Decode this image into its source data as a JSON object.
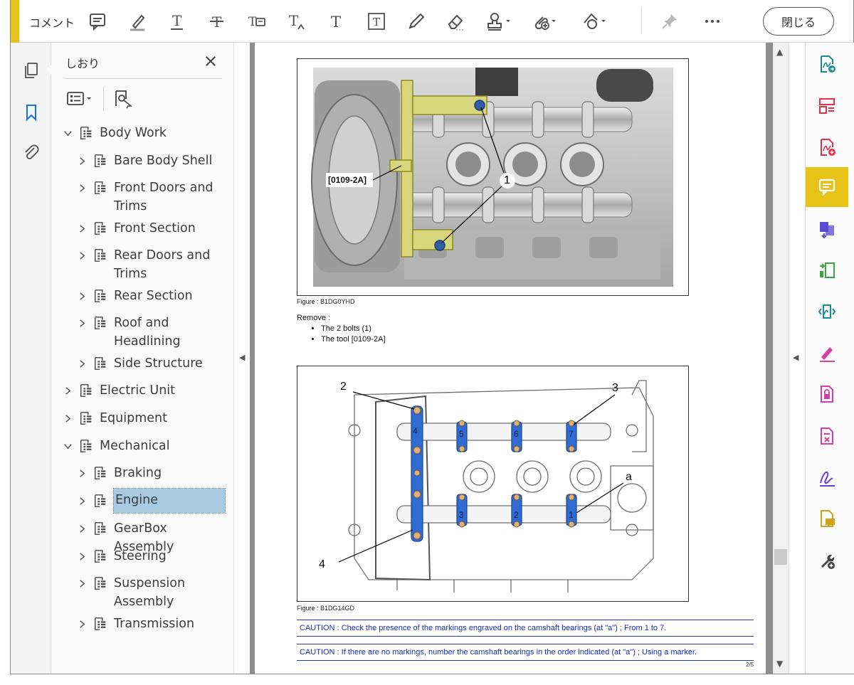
{
  "toolbar": {
    "title": "コメント",
    "close_label": "閉じる",
    "tools": [
      {
        "name": "sticky-note-icon"
      },
      {
        "name": "highlight-icon"
      },
      {
        "name": "underline-text-icon"
      },
      {
        "name": "strikethrough-icon"
      },
      {
        "name": "replace-text-icon"
      },
      {
        "name": "insert-text-icon"
      },
      {
        "name": "add-text-icon"
      },
      {
        "name": "text-box-icon"
      },
      {
        "name": "pencil-icon"
      },
      {
        "name": "eraser-icon"
      },
      {
        "name": "stamp-icon"
      },
      {
        "name": "attach-file-icon"
      },
      {
        "name": "shapes-icon"
      },
      {
        "name": "pin-icon"
      },
      {
        "name": "more-icon"
      }
    ]
  },
  "left_strip": {
    "icons": [
      "page-thumbnails-icon",
      "bookmarks-icon",
      "attachments-icon"
    ]
  },
  "bookmarks": {
    "title": "しおり",
    "tree": [
      {
        "label": "Body Work",
        "level": 0,
        "expanded": true
      },
      {
        "label": "Bare Body Shell",
        "level": 1
      },
      {
        "label": "Front Doors and Trims",
        "level": 1
      },
      {
        "label": "Front Section",
        "level": 1
      },
      {
        "label": "Rear Doors and Trims",
        "level": 1
      },
      {
        "label": "Rear Section",
        "level": 1
      },
      {
        "label": "Roof and Headlining",
        "level": 1
      },
      {
        "label": "Side Structure",
        "level": 1
      },
      {
        "label": "Electric Unit",
        "level": 0
      },
      {
        "label": "Equipment",
        "level": 0
      },
      {
        "label": "Mechanical",
        "level": 0,
        "expanded": true
      },
      {
        "label": "Braking",
        "level": 1
      },
      {
        "label": "Engine",
        "level": 1,
        "selected": true
      },
      {
        "label": "GearBox Assembly",
        "level": 1
      },
      {
        "label": "Steering",
        "level": 1
      },
      {
        "label": "Suspension Assembly",
        "level": 1
      },
      {
        "label": "Transmission",
        "level": 1
      }
    ]
  },
  "document": {
    "figure1": {
      "caption": "Figure : B1DG0YHD",
      "tool_label": "[0109-2A]",
      "callout": "1"
    },
    "remove_heading": "Remove :",
    "remove_items": [
      "The 2 bolts (1)",
      "The tool [0109-2A]"
    ],
    "figure2": {
      "caption": "Figure : B1DG14GD",
      "labels": {
        "l2": "2",
        "l3": "3",
        "l4": "4",
        "la": "a"
      },
      "bearings_top": [
        "4",
        "5",
        "6",
        "7"
      ],
      "bearings_bottom": [
        "3",
        "2",
        "1"
      ]
    },
    "caution1": "CAUTION : Check the presence of the markings engraved on the camshaft bearings (at \"a\") ; From 1 to 7.",
    "caution2": "CAUTION : If there are no markings, number the camshaft bearings in the order indicated (at \"a\") ; Using a marker.",
    "page_number": "2/5"
  },
  "right_rail": {
    "icons": [
      {
        "name": "export-pdf-icon",
        "color": "#1c8c8c"
      },
      {
        "name": "organize-pages-icon",
        "color": "#e0344b"
      },
      {
        "name": "create-pdf-icon",
        "color": "#e0344b"
      },
      {
        "name": "comment-icon",
        "color": "#ffffff",
        "active": true
      },
      {
        "name": "combine-files-icon",
        "color": "#5a4bd4"
      },
      {
        "name": "compress-pdf-icon",
        "color": "#3aa544"
      },
      {
        "name": "compare-files-icon",
        "color": "#1c8c8c"
      },
      {
        "name": "fill-sign-icon",
        "color": "#d43fa3"
      },
      {
        "name": "protect-icon",
        "color": "#d43fa3"
      },
      {
        "name": "redact-icon",
        "color": "#d43fa3"
      },
      {
        "name": "request-signature-icon",
        "color": "#6a3fd4"
      },
      {
        "name": "send-comments-icon",
        "color": "#d4a117"
      },
      {
        "name": "more-tools-icon",
        "color": "#444444"
      }
    ]
  },
  "colors": {
    "accent": "#e8c317",
    "selection": "#a9cbe2",
    "caution_text": "#1a2fb6"
  }
}
